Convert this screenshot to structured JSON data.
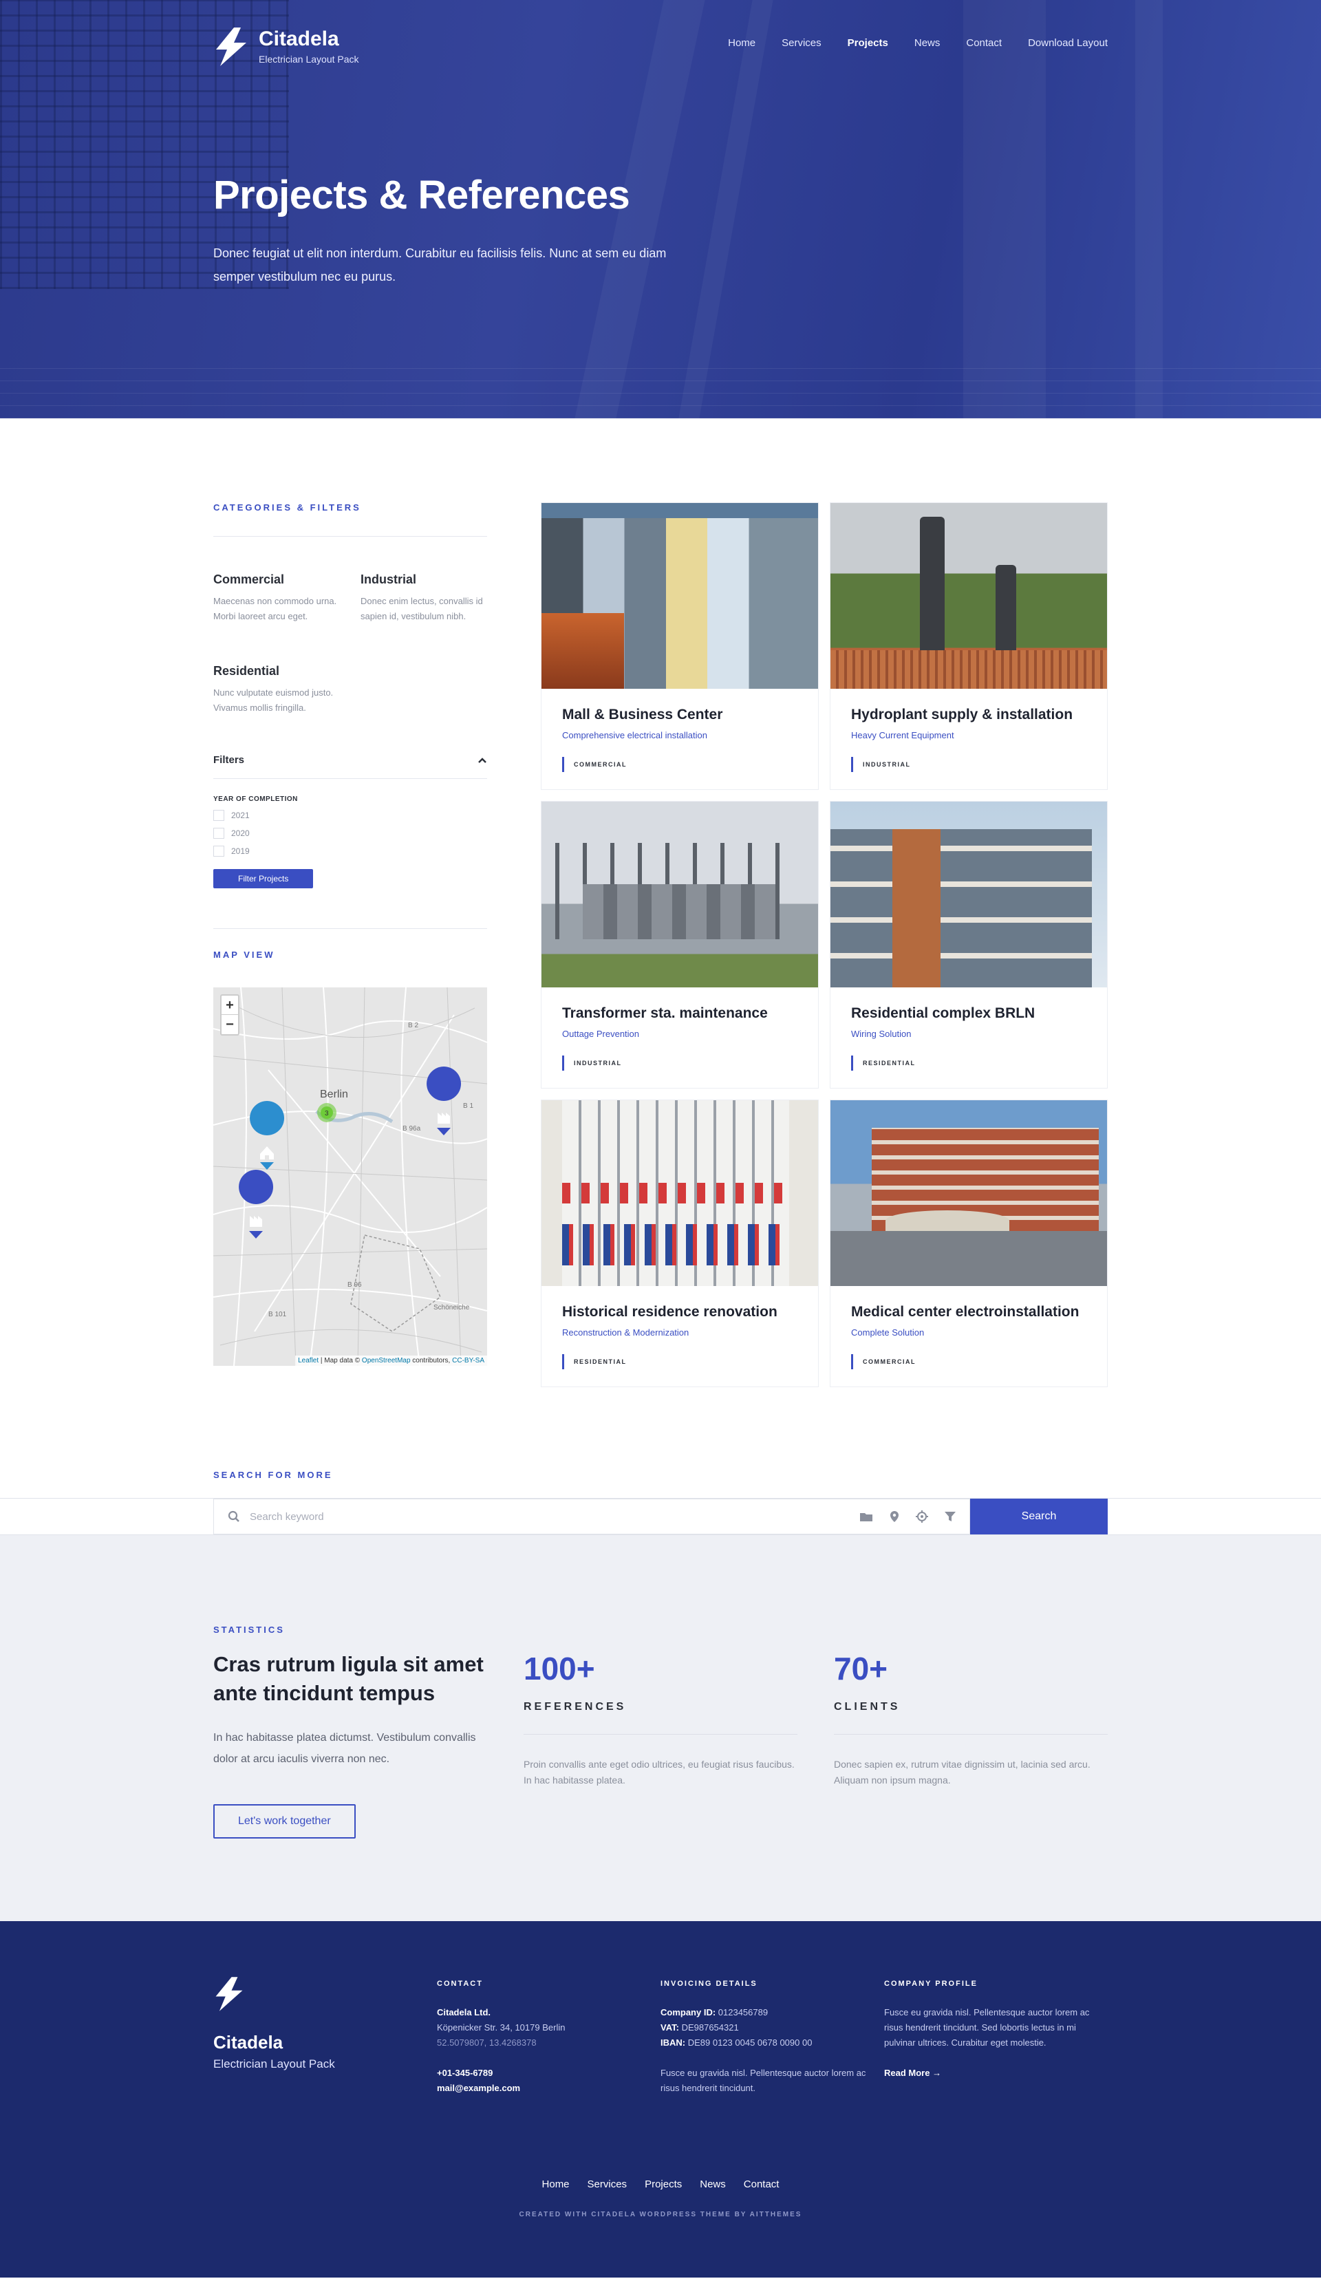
{
  "brand": {
    "name": "Citadela",
    "tagline": "Electrician Layout Pack"
  },
  "nav": [
    "Home",
    "Services",
    "Projects",
    "News",
    "Contact",
    "Download Layout"
  ],
  "nav_active": "Projects",
  "hero": {
    "title": "Projects & References",
    "text": "Donec feugiat ut elit non interdum. Curabitur eu facilisis felis. Nunc at sem eu diam semper vestibulum nec eu purus."
  },
  "sidebar": {
    "heading": "CATEGORIES & FILTERS",
    "categories": [
      {
        "name": "Commercial",
        "desc": "Maecenas non commodo urna. Morbi laoreet arcu eget."
      },
      {
        "name": "Industrial",
        "desc": "Donec enim lectus, convallis id sapien id, vestibulum nibh."
      },
      {
        "name": "Residential",
        "desc": "Nunc vulputate euismod justo. Vivamus mollis fringilla."
      }
    ],
    "filters_label": "Filters",
    "year_label": "YEAR OF COMPLETION",
    "years": [
      "2021",
      "2020",
      "2019"
    ],
    "filter_button": "Filter Projects",
    "map_heading": "MAP VIEW"
  },
  "map": {
    "zoom_in": "+",
    "zoom_out": "−",
    "city_label": "Berlin",
    "cluster_count": "3",
    "road_labels": [
      "B 2",
      "B 1",
      "B 96a",
      "B 96",
      "B 101",
      "Schöneiche"
    ],
    "attribution": {
      "leaflet": "Leaflet",
      "mid": " | Map data © ",
      "osm": "OpenStreetMap",
      "contrib": " contributors, ",
      "license": "CC-BY-SA"
    }
  },
  "projects": [
    {
      "title": "Mall & Business Center",
      "subtitle": "Comprehensive electrical installation",
      "tag": "COMMERCIAL"
    },
    {
      "title": "Hydroplant supply & installation",
      "subtitle": "Heavy Current Equipment",
      "tag": "INDUSTRIAL"
    },
    {
      "title": "Transformer sta. maintenance",
      "subtitle": "Outtage Prevention",
      "tag": "INDUSTRIAL"
    },
    {
      "title": "Residential complex BRLN",
      "subtitle": "Wiring Solution",
      "tag": "RESIDENTIAL"
    },
    {
      "title": "Historical residence renovation",
      "subtitle": "Reconstruction & Modernization",
      "tag": "RESIDENTIAL"
    },
    {
      "title": "Medical center electroinstallation",
      "subtitle": "Complete Solution",
      "tag": "COMMERCIAL"
    }
  ],
  "search": {
    "heading": "SEARCH FOR MORE",
    "placeholder": "Search keyword",
    "button": "Search"
  },
  "stats": {
    "eyebrow": "STATISTICS",
    "title": "Cras rutrum ligula sit amet ante tincidunt tempus",
    "text": "In hac habitasse platea dictumst. Vestibulum convallis dolor at arcu iaculis viverra non nec.",
    "button": "Let's work together",
    "items": [
      {
        "num": "100+",
        "label": "REFERENCES",
        "text": "Proin convallis ante eget odio ultrices, eu feugiat risus faucibus. In hac habitasse platea."
      },
      {
        "num": "70+",
        "label": "CLIENTS",
        "text": "Donec sapien ex, rutrum vitae dignissim ut, lacinia sed arcu. Aliquam non ipsum magna."
      }
    ]
  },
  "footer": {
    "contact": {
      "heading": "CONTACT",
      "company": "Citadela Ltd.",
      "address": "Köpenicker Str. 34, 10179 Berlin",
      "coords": "52.5079807, 13.4268378",
      "phone": "+01-345-6789",
      "email": "mail@example.com"
    },
    "invoicing": {
      "heading": "INVOICING DETAILS",
      "company_id_label": "Company ID:",
      "company_id": " 0123456789",
      "vat_label": "VAT:",
      "vat": " DE987654321",
      "iban_label": "IBAN:",
      "iban": " DE89 0123 0045 0678 0090 00",
      "text": "Fusce eu gravida nisl. Pellentesque auctor lorem ac risus hendrerit tincidunt."
    },
    "profile": {
      "heading": "COMPANY PROFILE",
      "text": "Fusce eu gravida nisl. Pellentesque auctor lorem ac risus hendrerit tincidunt. Sed lobortis lectus in mi pulvinar ultrices. Curabitur eget molestie.",
      "read_more": "Read More"
    },
    "nav": [
      "Home",
      "Services",
      "Projects",
      "News",
      "Contact"
    ],
    "credit": "CREATED WITH CITADELA WORDPRESS THEME BY AITTHEMES"
  },
  "colors": {
    "accent": "#3a4ec2",
    "footer_bg": "#1c2a6d",
    "stats_bg": "#eef0f5"
  }
}
